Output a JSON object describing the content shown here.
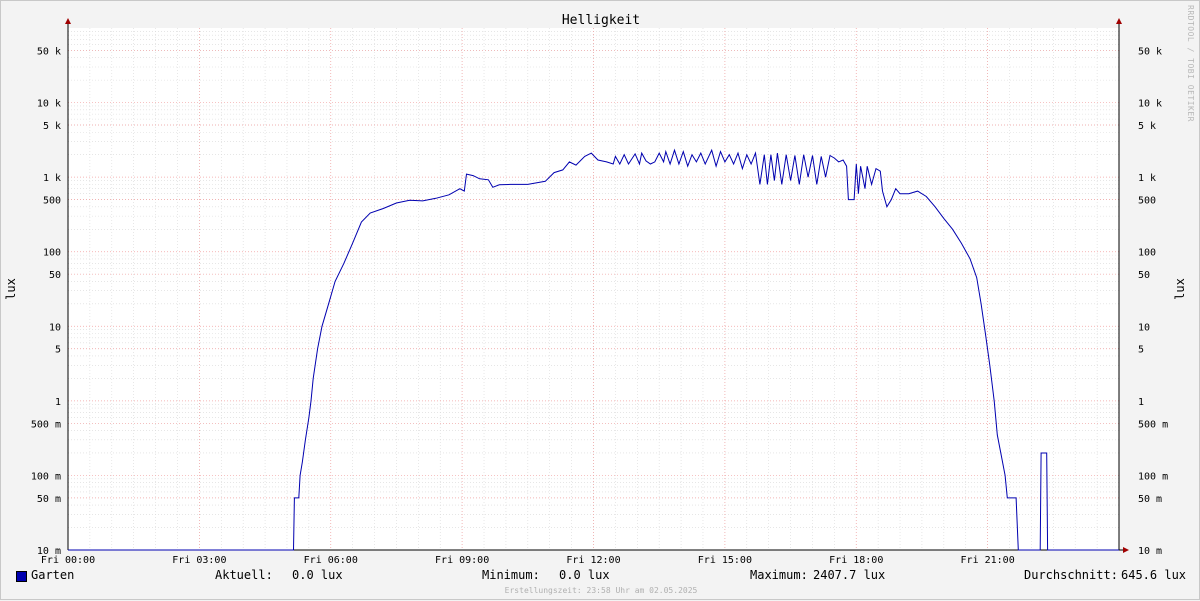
{
  "chart_data": {
    "type": "line",
    "title": "Helligkeit",
    "ylabel": "lux",
    "y_scale": "log",
    "ylim": [
      0.01,
      100000
    ],
    "x_range_hours": [
      0,
      24
    ],
    "x_ticks": [
      {
        "label": "Fri 00:00",
        "hour": 0
      },
      {
        "label": "Fri 03:00",
        "hour": 3
      },
      {
        "label": "Fri 06:00",
        "hour": 6
      },
      {
        "label": "Fri 09:00",
        "hour": 9
      },
      {
        "label": "Fri 12:00",
        "hour": 12
      },
      {
        "label": "Fri 15:00",
        "hour": 15
      },
      {
        "label": "Fri 18:00",
        "hour": 18
      },
      {
        "label": "Fri 21:00",
        "hour": 21
      }
    ],
    "y_ticks": [
      {
        "label": "10 m",
        "value": 0.01
      },
      {
        "label": "50 m",
        "value": 0.05
      },
      {
        "label": "100 m",
        "value": 0.1
      },
      {
        "label": "500 m",
        "value": 0.5
      },
      {
        "label": "1",
        "value": 1
      },
      {
        "label": "5",
        "value": 5
      },
      {
        "label": "10",
        "value": 10
      },
      {
        "label": "50",
        "value": 50
      },
      {
        "label": "100",
        "value": 100
      },
      {
        "label": "500",
        "value": 500
      },
      {
        "label": "1 k",
        "value": 1000
      },
      {
        "label": "5 k",
        "value": 5000
      },
      {
        "label": "10 k",
        "value": 10000
      },
      {
        "label": "50 k",
        "value": 50000
      }
    ],
    "grid": true,
    "legend_position": "bottom-left",
    "series": [
      {
        "name": "Garten",
        "color": "#0000b0",
        "points": [
          [
            0,
            0.01
          ],
          [
            5.15,
            0.01
          ],
          [
            5.17,
            0.05
          ],
          [
            5.27,
            0.05
          ],
          [
            5.3,
            0.1
          ],
          [
            5.35,
            0.15
          ],
          [
            5.42,
            0.3
          ],
          [
            5.5,
            0.6
          ],
          [
            5.55,
            1
          ],
          [
            5.6,
            2
          ],
          [
            5.7,
            5
          ],
          [
            5.8,
            10
          ],
          [
            5.95,
            20
          ],
          [
            6.1,
            40
          ],
          [
            6.3,
            70
          ],
          [
            6.5,
            130
          ],
          [
            6.7,
            250
          ],
          [
            6.9,
            330
          ],
          [
            7.2,
            380
          ],
          [
            7.5,
            450
          ],
          [
            7.8,
            490
          ],
          [
            8.1,
            480
          ],
          [
            8.4,
            520
          ],
          [
            8.7,
            580
          ],
          [
            8.95,
            700
          ],
          [
            9.05,
            650
          ],
          [
            9.1,
            1100
          ],
          [
            9.25,
            1050
          ],
          [
            9.4,
            950
          ],
          [
            9.6,
            920
          ],
          [
            9.7,
            730
          ],
          [
            9.85,
            790
          ],
          [
            10.1,
            800
          ],
          [
            10.5,
            800
          ],
          [
            10.9,
            880
          ],
          [
            11.1,
            1150
          ],
          [
            11.3,
            1250
          ],
          [
            11.45,
            1600
          ],
          [
            11.6,
            1450
          ],
          [
            11.8,
            1900
          ],
          [
            11.95,
            2100
          ],
          [
            12.1,
            1700
          ],
          [
            12.3,
            1600
          ],
          [
            12.45,
            1500
          ],
          [
            12.5,
            1900
          ],
          [
            12.6,
            1500
          ],
          [
            12.7,
            2000
          ],
          [
            12.8,
            1500
          ],
          [
            12.95,
            2050
          ],
          [
            13.05,
            1500
          ],
          [
            13.1,
            2100
          ],
          [
            13.2,
            1650
          ],
          [
            13.3,
            1500
          ],
          [
            13.4,
            1600
          ],
          [
            13.5,
            2100
          ],
          [
            13.6,
            1600
          ],
          [
            13.65,
            2200
          ],
          [
            13.75,
            1500
          ],
          [
            13.85,
            2300
          ],
          [
            13.95,
            1500
          ],
          [
            14.05,
            2200
          ],
          [
            14.15,
            1400
          ],
          [
            14.25,
            2000
          ],
          [
            14.35,
            1600
          ],
          [
            14.45,
            2100
          ],
          [
            14.55,
            1500
          ],
          [
            14.7,
            2300
          ],
          [
            14.8,
            1400
          ],
          [
            14.9,
            2200
          ],
          [
            15.0,
            1600
          ],
          [
            15.1,
            2000
          ],
          [
            15.2,
            1500
          ],
          [
            15.3,
            2100
          ],
          [
            15.4,
            1300
          ],
          [
            15.5,
            2000
          ],
          [
            15.6,
            1500
          ],
          [
            15.7,
            2100
          ],
          [
            15.8,
            800
          ],
          [
            15.9,
            2000
          ],
          [
            15.97,
            800
          ],
          [
            16.05,
            2000
          ],
          [
            16.13,
            900
          ],
          [
            16.2,
            2100
          ],
          [
            16.3,
            800
          ],
          [
            16.4,
            2000
          ],
          [
            16.5,
            900
          ],
          [
            16.6,
            1950
          ],
          [
            16.7,
            800
          ],
          [
            16.8,
            2000
          ],
          [
            16.9,
            1000
          ],
          [
            17.0,
            1950
          ],
          [
            17.1,
            800
          ],
          [
            17.2,
            1900
          ],
          [
            17.3,
            1000
          ],
          [
            17.4,
            1950
          ],
          [
            17.5,
            1800
          ],
          [
            17.6,
            1600
          ],
          [
            17.7,
            1700
          ],
          [
            17.78,
            1400
          ],
          [
            17.82,
            500
          ],
          [
            17.95,
            500
          ],
          [
            18.0,
            1500
          ],
          [
            18.05,
            600
          ],
          [
            18.1,
            1400
          ],
          [
            18.2,
            700
          ],
          [
            18.25,
            1400
          ],
          [
            18.35,
            800
          ],
          [
            18.45,
            1300
          ],
          [
            18.55,
            1200
          ],
          [
            18.6,
            650
          ],
          [
            18.7,
            400
          ],
          [
            18.8,
            500
          ],
          [
            18.9,
            700
          ],
          [
            19.0,
            600
          ],
          [
            19.2,
            600
          ],
          [
            19.4,
            650
          ],
          [
            19.6,
            550
          ],
          [
            19.8,
            400
          ],
          [
            20.0,
            280
          ],
          [
            20.2,
            200
          ],
          [
            20.4,
            130
          ],
          [
            20.6,
            80
          ],
          [
            20.75,
            45
          ],
          [
            20.85,
            20
          ],
          [
            20.95,
            8
          ],
          [
            21.05,
            3
          ],
          [
            21.15,
            1
          ],
          [
            21.22,
            0.35
          ],
          [
            21.3,
            0.2
          ],
          [
            21.4,
            0.1
          ],
          [
            21.45,
            0.05
          ],
          [
            21.65,
            0.05
          ],
          [
            21.7,
            0.01
          ],
          [
            22.2,
            0.01
          ],
          [
            22.22,
            0.2
          ],
          [
            22.35,
            0.2
          ],
          [
            22.37,
            0.01
          ],
          [
            24,
            0.01
          ]
        ]
      }
    ]
  },
  "legend": {
    "series_name": "Garten",
    "aktuell_label": "Aktuell:",
    "aktuell_value": "0.0 lux",
    "minimum_label": "Minimum:",
    "minimum_value": "0.0 lux",
    "maximum_label": "Maximum:",
    "maximum_value": "2407.7 lux",
    "avg_label": "Durchschnitt:",
    "avg_value": "645.6 lux"
  },
  "footer": "Erstellungszeit: 23:58 Uhr am 02.05.2025",
  "watermark": "RRDTOOL / TOBI OETIKER"
}
